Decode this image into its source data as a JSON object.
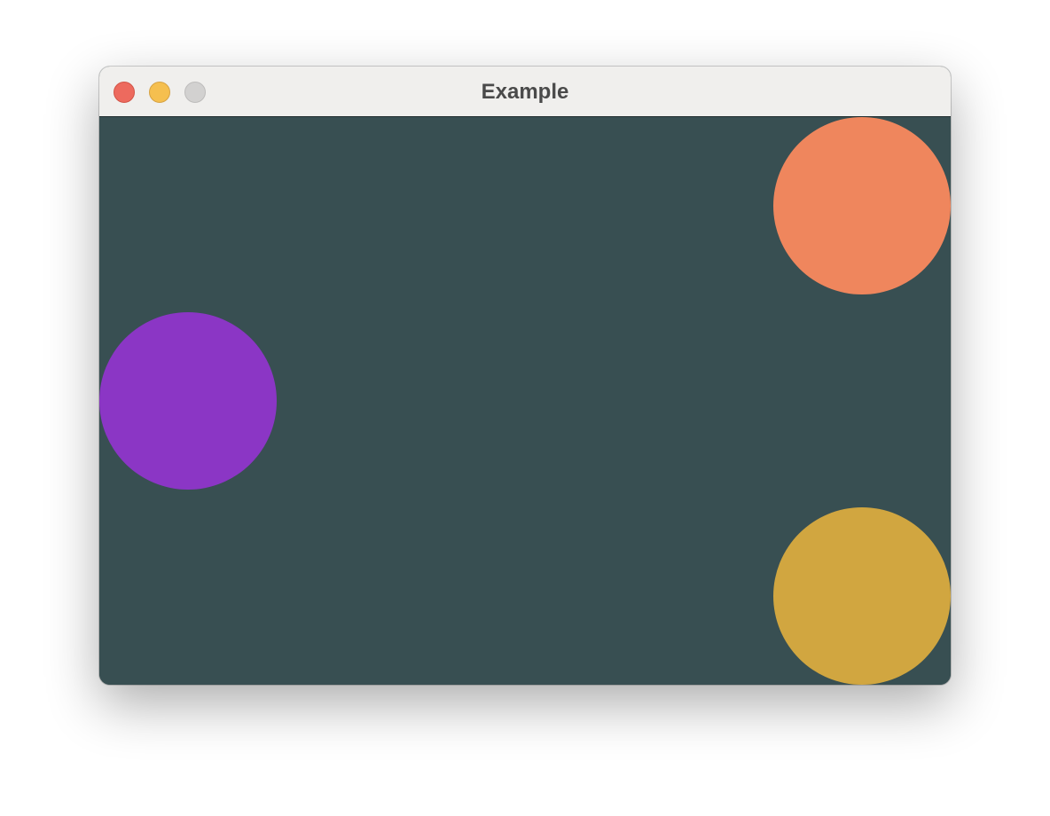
{
  "window": {
    "title": "Example",
    "controls": {
      "close_color": "#ed6a5e",
      "close_border": "#d25447",
      "minimize_color": "#f5bf4f",
      "minimize_border": "#d6a243",
      "zoom_color": "#d2d1d0",
      "zoom_border": "#bdbcbb"
    }
  },
  "canvas": {
    "background": "#384f52",
    "circles": [
      {
        "name": "orange-circle",
        "color": "#ef865d"
      },
      {
        "name": "purple-circle",
        "color": "#8b36c5"
      },
      {
        "name": "gold-circle",
        "color": "#d1a640"
      }
    ]
  }
}
